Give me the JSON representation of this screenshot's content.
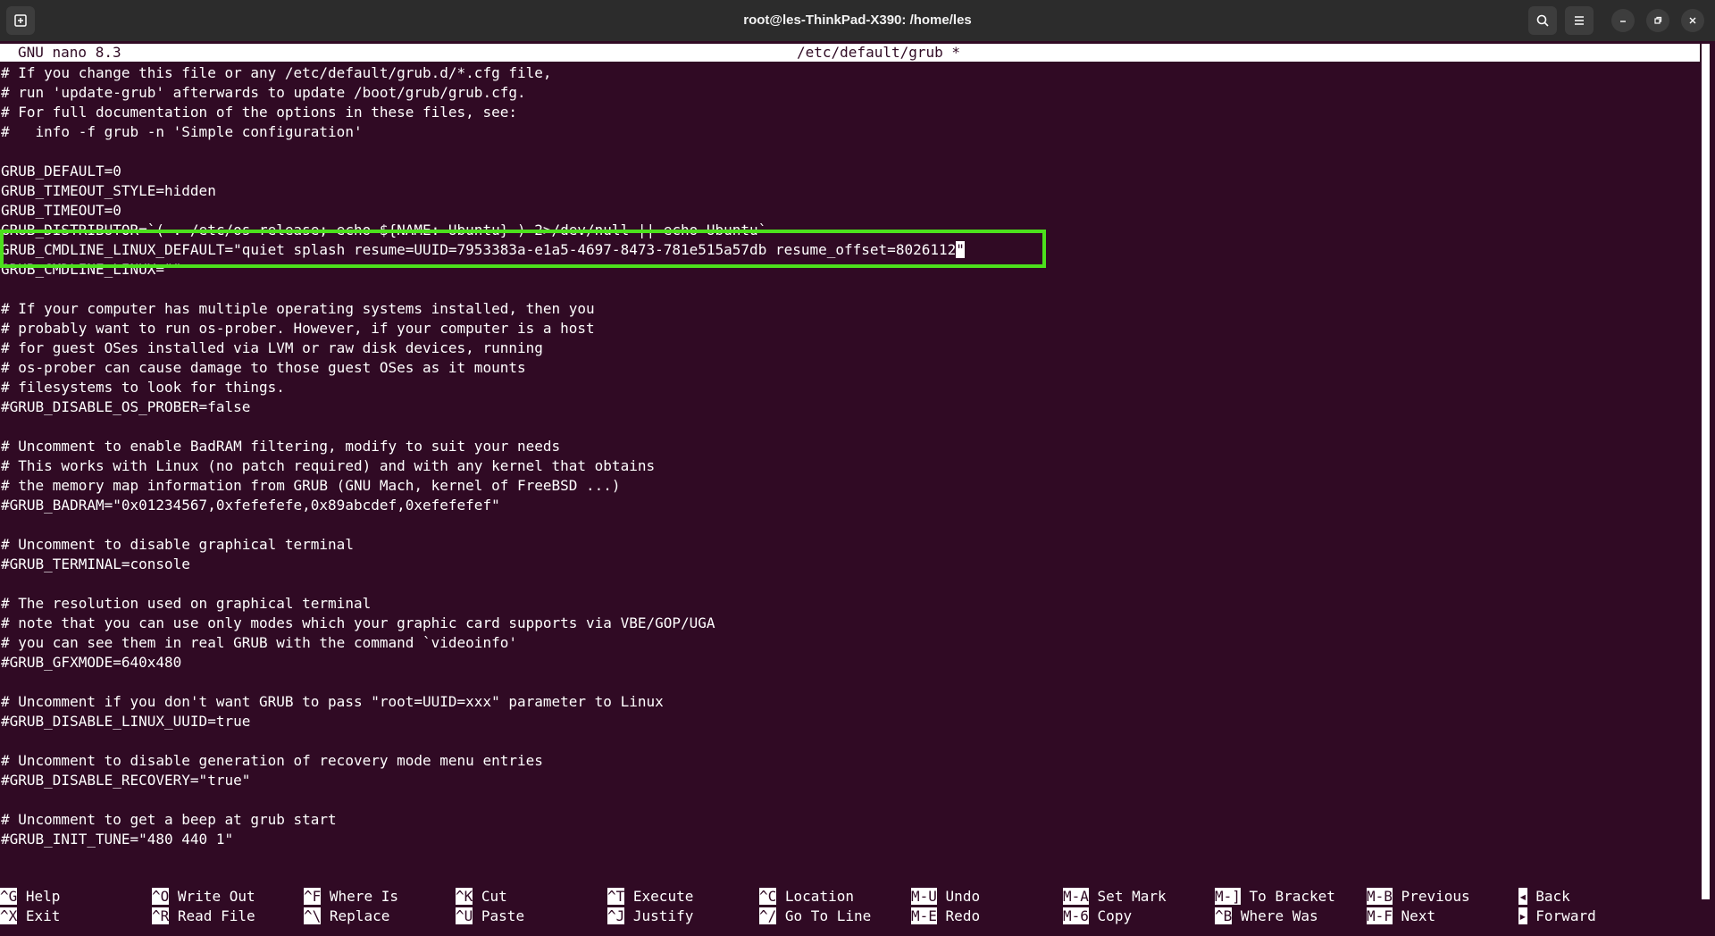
{
  "window": {
    "title": "root@les-ThinkPad-X390: /home/les"
  },
  "icons": {
    "new_tab": "new-tab-icon",
    "search": "search-icon",
    "menu": "hamburger-menu-icon",
    "minimize": "minimize-icon",
    "restore": "restore-icon",
    "close": "close-icon"
  },
  "nano": {
    "version": "GNU nano 8.3",
    "filename": "/etc/default/grub *"
  },
  "colors": {
    "terminal_bg": "#300a24",
    "highlight_border": "#4ce01c"
  },
  "file_lines": [
    "# If you change this file or any /etc/default/grub.d/*.cfg file,",
    "# run 'update-grub' afterwards to update /boot/grub/grub.cfg.",
    "# For full documentation of the options in these files, see:",
    "#   info -f grub -n 'Simple configuration'",
    "",
    "GRUB_DEFAULT=0",
    "GRUB_TIMEOUT_STYLE=hidden",
    "GRUB_TIMEOUT=0",
    "GRUB_DISTRIBUTOR=`( . /etc/os-release; echo ${NAME:-Ubuntu} ) 2>/dev/null || echo Ubuntu`",
    "GRUB_CMDLINE_LINUX_DEFAULT=\"quiet splash resume=UUID=7953383a-e1a5-4697-8473-781e515a57db resume_offset=8026112",
    "GRUB_CMDLINE_LINUX=\"\"",
    "",
    "# If your computer has multiple operating systems installed, then you",
    "# probably want to run os-prober. However, if your computer is a host",
    "# for guest OSes installed via LVM or raw disk devices, running",
    "# os-prober can cause damage to those guest OSes as it mounts",
    "# filesystems to look for things.",
    "#GRUB_DISABLE_OS_PROBER=false",
    "",
    "# Uncomment to enable BadRAM filtering, modify to suit your needs",
    "# This works with Linux (no patch required) and with any kernel that obtains",
    "# the memory map information from GRUB (GNU Mach, kernel of FreeBSD ...)",
    "#GRUB_BADRAM=\"0x01234567,0xfefefefe,0x89abcdef,0xefefefef\"",
    "",
    "# Uncomment to disable graphical terminal",
    "#GRUB_TERMINAL=console",
    "",
    "# The resolution used on graphical terminal",
    "# note that you can use only modes which your graphic card supports via VBE/GOP/UGA",
    "# you can see them in real GRUB with the command `videoinfo'",
    "#GRUB_GFXMODE=640x480",
    "",
    "# Uncomment if you don't want GRUB to pass \"root=UUID=xxx\" parameter to Linux",
    "#GRUB_DISABLE_LINUX_UUID=true",
    "",
    "# Uncomment to disable generation of recovery mode menu entries",
    "#GRUB_DISABLE_RECOVERY=\"true\"",
    "",
    "# Uncomment to get a beep at grub start",
    "#GRUB_INIT_TUNE=\"480 440 1\""
  ],
  "cursor_char": "\"",
  "shortcuts": [
    {
      "key": "^G",
      "label": "Help"
    },
    {
      "key": "^X",
      "label": "Exit"
    },
    {
      "key": "^O",
      "label": "Write Out"
    },
    {
      "key": "^R",
      "label": "Read File"
    },
    {
      "key": "^F",
      "label": "Where Is"
    },
    {
      "key": "^\\",
      "label": "Replace"
    },
    {
      "key": "^K",
      "label": "Cut"
    },
    {
      "key": "^U",
      "label": "Paste"
    },
    {
      "key": "^T",
      "label": "Execute"
    },
    {
      "key": "^J",
      "label": "Justify"
    },
    {
      "key": "^C",
      "label": "Location"
    },
    {
      "key": "^/",
      "label": "Go To Line"
    },
    {
      "key": "M-U",
      "label": "Undo"
    },
    {
      "key": "M-E",
      "label": "Redo"
    },
    {
      "key": "M-A",
      "label": "Set Mark"
    },
    {
      "key": "M-6",
      "label": "Copy"
    },
    {
      "key": "M-]",
      "label": "To Bracket"
    },
    {
      "key": "^B",
      "label": "Where Was"
    },
    {
      "key": "M-B",
      "label": "Previous"
    },
    {
      "key": "M-F",
      "label": "Next"
    },
    {
      "key": "◂",
      "label": "Back"
    },
    {
      "key": "▸",
      "label": "Forward"
    }
  ]
}
